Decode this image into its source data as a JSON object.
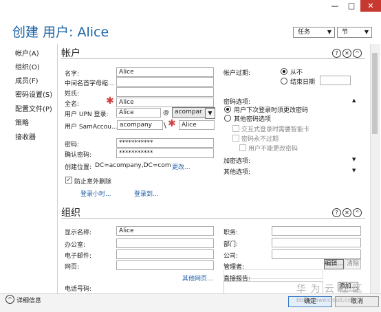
{
  "window": {
    "title_prefix": "创建 用户:",
    "user": "Alice",
    "btn_min": "—",
    "btn_max": "□",
    "btn_close": "✕"
  },
  "header": {
    "tasks_label": "任务",
    "sections_label": "节"
  },
  "nav": [
    "帐户(A)",
    "组织(O)",
    "成员(F)",
    "密码设置(S)",
    "配置文件(P)",
    "策略",
    "接收器"
  ],
  "account": {
    "heading": "帐户",
    "first_name_label": "名字:",
    "first_name": "Alice",
    "middle_initials_label": "中间名首字母缩...",
    "last_name_label": "姓氏:",
    "full_name_label": "全名:",
    "full_name": "Alice",
    "upn_label": "用户 UPN 登录:",
    "upn_value": "Alice",
    "upn_at": "@",
    "upn_domain": "acompar",
    "sam_label": "用户 SamAccou...",
    "sam_domain": "acompany",
    "sam_sep": "\\",
    "sam_value": "Alice",
    "password_label": "密码:",
    "password": "***********",
    "confirm_label": "确认密码:",
    "confirm": "***********",
    "location_label": "创建位置:",
    "location": "DC=acompany,DC=com",
    "change_link": "更改...",
    "protect_label": "防止意外删除",
    "logon_hours_link": "登录小时...",
    "logon_to_link": "登录到...",
    "expiry_label": "帐户过期:",
    "expiry_never": "从不",
    "expiry_end": "结束日期",
    "pwd_options_label": "密码选项:",
    "pwd_opt_change": "用户下次登录时须更改密码",
    "pwd_opt_other": "其他密码选项",
    "smartcard": "交互式登录时需要智能卡",
    "never_expire": "密码永不过期",
    "cannot_change": "用户不能更改密码",
    "encryption": "加密选项:",
    "other_options": "其他选项:"
  },
  "organization": {
    "heading": "组织",
    "display_label": "显示名称:",
    "display": "Alice",
    "office_label": "办公室:",
    "email_label": "电子邮件:",
    "web_label": "网页:",
    "more_web_link": "其他网页...",
    "phone_label": "电话号码:",
    "title_label": "职务:",
    "dept_label": "部门:",
    "company_label": "公司:",
    "manager_label": "管理者:",
    "edit_btn": "编辑...",
    "clear_btn": "清除",
    "direct_label": "直接报告:",
    "add_btn": "添加..."
  },
  "footer": {
    "details": "详细信息",
    "ok": "确定",
    "cancel": "取消"
  },
  "watermark": {
    "text": "华 为 云 社 区",
    "url": "bbs.huaweicloud.com"
  }
}
